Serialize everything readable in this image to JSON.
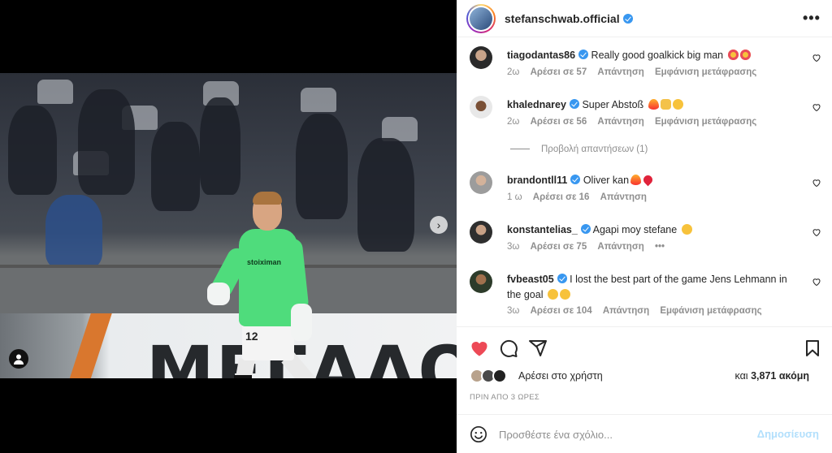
{
  "post": {
    "owner": "stefanschwab.official",
    "board_text": "ΜΕΓΑΛΟΣ",
    "shirt_sponsor": "stoiximan",
    "shirt_number": "12"
  },
  "colors": {
    "like_red": "#ed4956",
    "verified_blue": "#3897f0",
    "muted": "#8e8e8e",
    "post_button": "#b2dffc"
  },
  "comments": [
    {
      "user": "tiagodantas86",
      "verified": true,
      "text": "Really good goalkick big man",
      "emojis": [
        "star-struck-emoji",
        "star-struck-emoji"
      ],
      "time": "2ω",
      "likes": "Αρέσει σε 57",
      "reply": "Απάντηση",
      "translate": "Εμφάνιση μετάφρασης"
    },
    {
      "user": "khalednarey",
      "verified": true,
      "text": "Super Abstoß",
      "emojis": [
        "fire-emoji",
        "clap-emoji",
        "smile-emoji"
      ],
      "time": "2ω",
      "likes": "Αρέσει σε 56",
      "reply": "Απάντηση",
      "translate": "Εμφάνιση μετάφρασης"
    },
    {
      "user": "brandontll11",
      "verified": true,
      "text": "Oliver kan",
      "emojis": [
        "fire-emoji",
        "heart-emoji"
      ],
      "time": "1 ω",
      "likes": "Αρέσει σε 16",
      "reply": "Απάντηση"
    },
    {
      "user": "konstantelias_",
      "verified": true,
      "text": "Agapi moy stefane",
      "emojis": [
        "tears-of-joy-emoji"
      ],
      "time": "3ω",
      "likes": "Αρέσει σε 75",
      "reply": "Απάντηση",
      "more": "•••"
    },
    {
      "user": "fvbeast05",
      "verified": true,
      "text": "I lost the best part of the game Jens Lehmann in the goal",
      "emojis": [
        "grin-sweat-emoji",
        "grin-sweat-emoji"
      ],
      "time": "3ω",
      "likes": "Αρέσει σε 104",
      "reply": "Απάντηση",
      "translate": "Εμφάνιση μετάφρασης"
    }
  ],
  "view_replies": "Προβολή απαντήσεων (1)",
  "likes_summary": {
    "liked_by": "Αρέσει στο χρήστη",
    "and": "και",
    "others": "3,871 ακόμη"
  },
  "timestamp": "ΠΡΙΝ ΑΠΟ 3 ΩΡΕΣ",
  "add_comment": {
    "placeholder": "Προσθέστε ένα σχόλιο...",
    "post_label": "Δημοσίευση"
  },
  "header_more": "•••"
}
